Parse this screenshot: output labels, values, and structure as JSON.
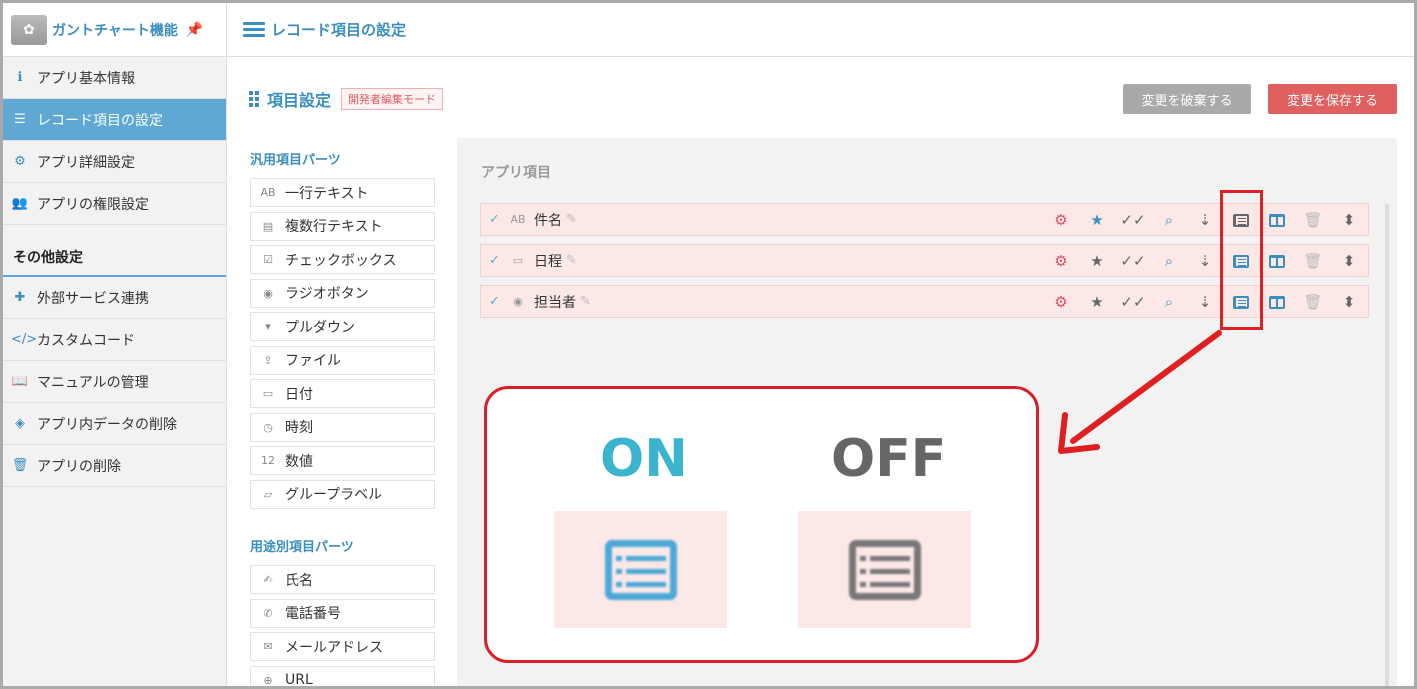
{
  "sidebar": {
    "app_name": "ガントチャート機能",
    "items": [
      {
        "label": "アプリ基本情報",
        "icon": "info-icon"
      },
      {
        "label": "レコード項目の設定",
        "icon": "list-icon",
        "active": true
      },
      {
        "label": "アプリ詳細設定",
        "icon": "gear-icon"
      },
      {
        "label": "アプリの権限設定",
        "icon": "users-icon"
      }
    ],
    "other_section": "その他設定",
    "other_items": [
      {
        "label": "外部サービス連携",
        "icon": "puzzle-icon"
      },
      {
        "label": "カスタムコード",
        "icon": "code-icon"
      },
      {
        "label": "マニュアルの管理",
        "icon": "book-icon"
      },
      {
        "label": "アプリ内データの削除",
        "icon": "eraser-icon"
      },
      {
        "label": "アプリの削除",
        "icon": "trash-icon"
      }
    ]
  },
  "header": {
    "title": "レコード項目の設定"
  },
  "section": {
    "title": "項目設定",
    "badge": "開発者編集モード",
    "discard_label": "変更を破棄する",
    "save_label": "変更を保存する"
  },
  "parts": {
    "general_title": "汎用項目パーツ",
    "general": [
      {
        "label": "一行テキスト",
        "icon": "AB"
      },
      {
        "label": "複数行テキスト",
        "icon": "▤"
      },
      {
        "label": "チェックボックス",
        "icon": "☑"
      },
      {
        "label": "ラジオボタン",
        "icon": "◉"
      },
      {
        "label": "プルダウン",
        "icon": "▾"
      },
      {
        "label": "ファイル",
        "icon": "⇪"
      },
      {
        "label": "日付",
        "icon": "▭"
      },
      {
        "label": "時刻",
        "icon": "◷"
      },
      {
        "label": "数値",
        "icon": "12"
      },
      {
        "label": "グループラベル",
        "icon": "▱"
      }
    ],
    "special_title": "用途別項目パーツ",
    "special": [
      {
        "label": "氏名",
        "icon": "✍"
      },
      {
        "label": "電話番号",
        "icon": "✆"
      },
      {
        "label": "メールアドレス",
        "icon": "✉"
      },
      {
        "label": "URL",
        "icon": "⊕"
      }
    ]
  },
  "app_items": {
    "title": "アプリ項目",
    "rows": [
      {
        "name": "件名",
        "icon": "AB",
        "star": "blue"
      },
      {
        "name": "日程",
        "icon": "▭",
        "star": "gray"
      },
      {
        "name": "担当者",
        "icon": "◉",
        "star": "gray"
      }
    ]
  },
  "callout": {
    "on_label": "ON",
    "off_label": "OFF"
  },
  "colors": {
    "accent": "#3a8fbf",
    "on": "#3ab4cf",
    "off": "#666666",
    "highlight": "#e02020"
  }
}
